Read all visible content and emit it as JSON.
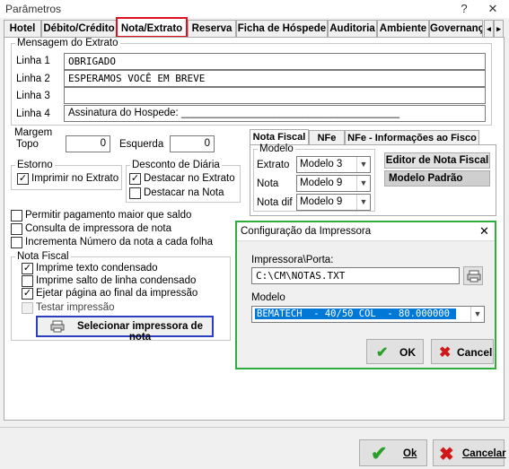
{
  "window": {
    "title": "Parâmetros",
    "help": "?",
    "close": "✕"
  },
  "tabs": [
    "Hotel",
    "Débito/Crédito",
    "Nota/Extrato",
    "Reserva",
    "Ficha de Hóspede",
    "Auditoria",
    "Ambiente",
    "Governanç"
  ],
  "tab_scroll": {
    "left": "◂",
    "right": "▸"
  },
  "mensagem": {
    "legend": "Mensagem do Extrato",
    "lines": [
      {
        "label": "Linha 1",
        "value": "OBRIGADO"
      },
      {
        "label": "Linha 2",
        "value": "ESPERAMOS VOCÊ EM BREVE"
      },
      {
        "label": "Linha 3",
        "value": ""
      },
      {
        "label": "Linha 4",
        "value": "Assinatura do Hospede: ______________________________________"
      }
    ]
  },
  "margem": {
    "legend": "Margem",
    "topo_label": "Topo",
    "topo_value": "0",
    "esquerda_label": "Esquerda",
    "esquerda_value": "0"
  },
  "estorno": {
    "legend": "Estorno",
    "imprimir_label": "Imprimir no Extrato",
    "imprimir_mark": "✓"
  },
  "desconto": {
    "legend": "Desconto de Diária",
    "destacar_extrato": "Destacar no Extrato",
    "destacar_extrato_mark": "✓",
    "destacar_nota": "Destacar na Nota"
  },
  "options": {
    "permitir": "Permitir pagamento maior que saldo",
    "consulta": "Consulta de impressora de nota",
    "incrementa": "Incrementa Número da nota a cada folha"
  },
  "nota_fiscal": {
    "legend": "Nota Fiscal",
    "condensado": "Imprime texto condensado",
    "condensado_mark": "✓",
    "salto": "Imprime salto de linha condensado",
    "ejetar": "Ejetar página ao final da impressão",
    "ejetar_mark": "✓",
    "testar": "Testar impressão",
    "selecionar_button": "Selecionar impressora de nota"
  },
  "subtabs": [
    "Nota Fiscal",
    "NFe",
    "NFe - Informações ao Fisco"
  ],
  "modelo": {
    "legend": "Modelo",
    "extrato_label": "Extrato",
    "extrato_value": "Modelo 3",
    "nota_label": "Nota",
    "nota_value": "Modelo 9",
    "notadif_label": "Nota dif",
    "notadif_value": "Modelo 9",
    "editor_button": "Editor de Nota Fiscal",
    "padrao_button": "Modelo Padrão"
  },
  "dialog": {
    "title": "Configuração da Impressora",
    "close": "✕",
    "porta_label": "Impressora\\Porta:",
    "porta_value": "C:\\CM\\NOTAS.TXT",
    "modelo_label": "Modelo",
    "modelo_value": "BEMATECH  - 40/50 COL  - 80.000000",
    "ok": "OK",
    "cancel": "Cancel"
  },
  "footer": {
    "ok": "Ok",
    "cancelar": "Cancelar"
  },
  "colors": {
    "active_tab_border": "#e0101e",
    "highlight_blue": "#2b3fc0",
    "dialog_green": "#2fae3b",
    "selected_row": "#0078d7"
  }
}
